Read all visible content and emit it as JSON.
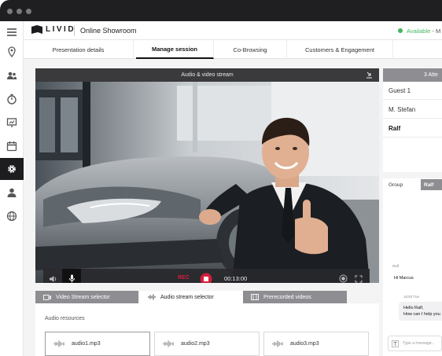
{
  "app": {
    "brand": "LIVID",
    "title": "Online Showroom",
    "status_label": "Available",
    "status_rest": "- M",
    "status_color": "#43b85c"
  },
  "sidebar": {
    "items": [
      {
        "icon": "menu-icon"
      },
      {
        "icon": "location-pin-icon"
      },
      {
        "icon": "users-icon"
      },
      {
        "icon": "timer-icon"
      },
      {
        "icon": "presentation-icon"
      },
      {
        "icon": "calendar-icon"
      },
      {
        "icon": "gear-icon",
        "active": true
      },
      {
        "icon": "user-icon"
      },
      {
        "icon": "globe-icon"
      }
    ]
  },
  "tabs": [
    {
      "label": "Presentation details"
    },
    {
      "label": "Manage session",
      "active": true
    },
    {
      "label": "Co-Browsing"
    },
    {
      "label": "Customers & Engagement"
    }
  ],
  "video": {
    "header": "Audio & video stream",
    "rec_label": "REC",
    "time": "00:13:00"
  },
  "lower_tabs": [
    {
      "label": "Video Stream selector",
      "icon": "video-icon"
    },
    {
      "label": "Audio stream selector",
      "icon": "audio-wave-icon",
      "active": true
    },
    {
      "label": "Prerecorded videos",
      "icon": "film-icon"
    }
  ],
  "audio": {
    "title": "Audio resources",
    "files": [
      "audio1.mp3",
      "audio2.mp3",
      "audio3.mp3"
    ]
  },
  "attendees": {
    "header": "3 Atte",
    "list": [
      "Guest 1",
      "M. Stefan",
      "Ralf"
    ]
  },
  "chat": {
    "tab_group": "Group",
    "tab_ralf": "Ralf",
    "msg1_sender": "Ralf",
    "msg1_text": "Hi Marcus",
    "msg2_time": "16:53 Tue",
    "msg2_line1": "Hello Ralf,",
    "msg2_line2": "How can I help you",
    "input_placeholder": "Type a message..."
  },
  "colors": {
    "accent_red": "#d21f3c",
    "sidebar_active": "#1d1d1f"
  }
}
